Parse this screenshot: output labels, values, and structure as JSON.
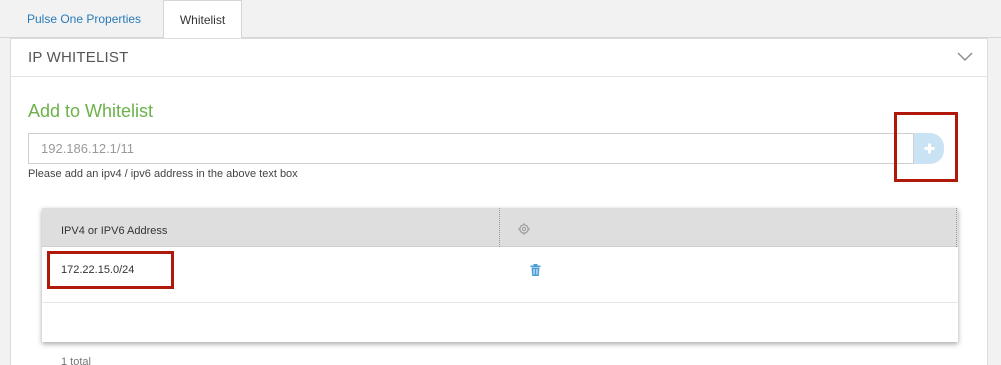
{
  "tabs": [
    {
      "label": "Pulse One Properties",
      "active": false
    },
    {
      "label": "Whitelist",
      "active": true
    }
  ],
  "panel": {
    "title": "IP WHITELIST",
    "collapse_icon": "chevron-down-icon"
  },
  "add_section": {
    "title": "Add to Whitelist",
    "input_placeholder": "192.186.12.1/11",
    "input_value": "",
    "help_text": "Please add an ipv4 / ipv6 address in the above text box",
    "add_icon": "plus-icon"
  },
  "table": {
    "columns": [
      {
        "label": "IPV4 or IPV6 Address"
      },
      {
        "label": "",
        "icon": "gear-icon"
      }
    ],
    "rows": [
      {
        "address": "172.22.15.0/24",
        "action_icon": "trash-icon"
      }
    ],
    "footer": "1 total"
  },
  "colors": {
    "accent_green": "#6bb24a",
    "link_blue": "#2a7ab8",
    "highlight_red": "#b0180a",
    "add_button_bg": "#c9e3f5"
  }
}
